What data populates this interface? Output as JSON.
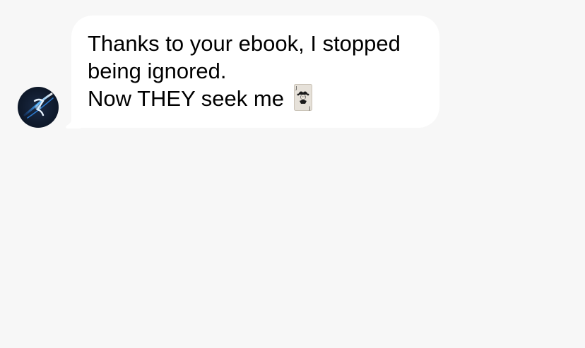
{
  "conversation": {
    "messages": [
      {
        "sender_avatar_icon": "avatar-swirl-logo-icon",
        "lines": [
          "Thanks to your ebook, I stopped",
          "being ignored.",
          "Now THEY seek me"
        ],
        "trailing_emoji": "joker-card-icon"
      }
    ]
  },
  "colors": {
    "background": "#f7f7f7",
    "bubble": "#ffffff",
    "text": "#000000",
    "avatar_bg": "#0f1a2c",
    "avatar_accent": "#2f8df0"
  }
}
